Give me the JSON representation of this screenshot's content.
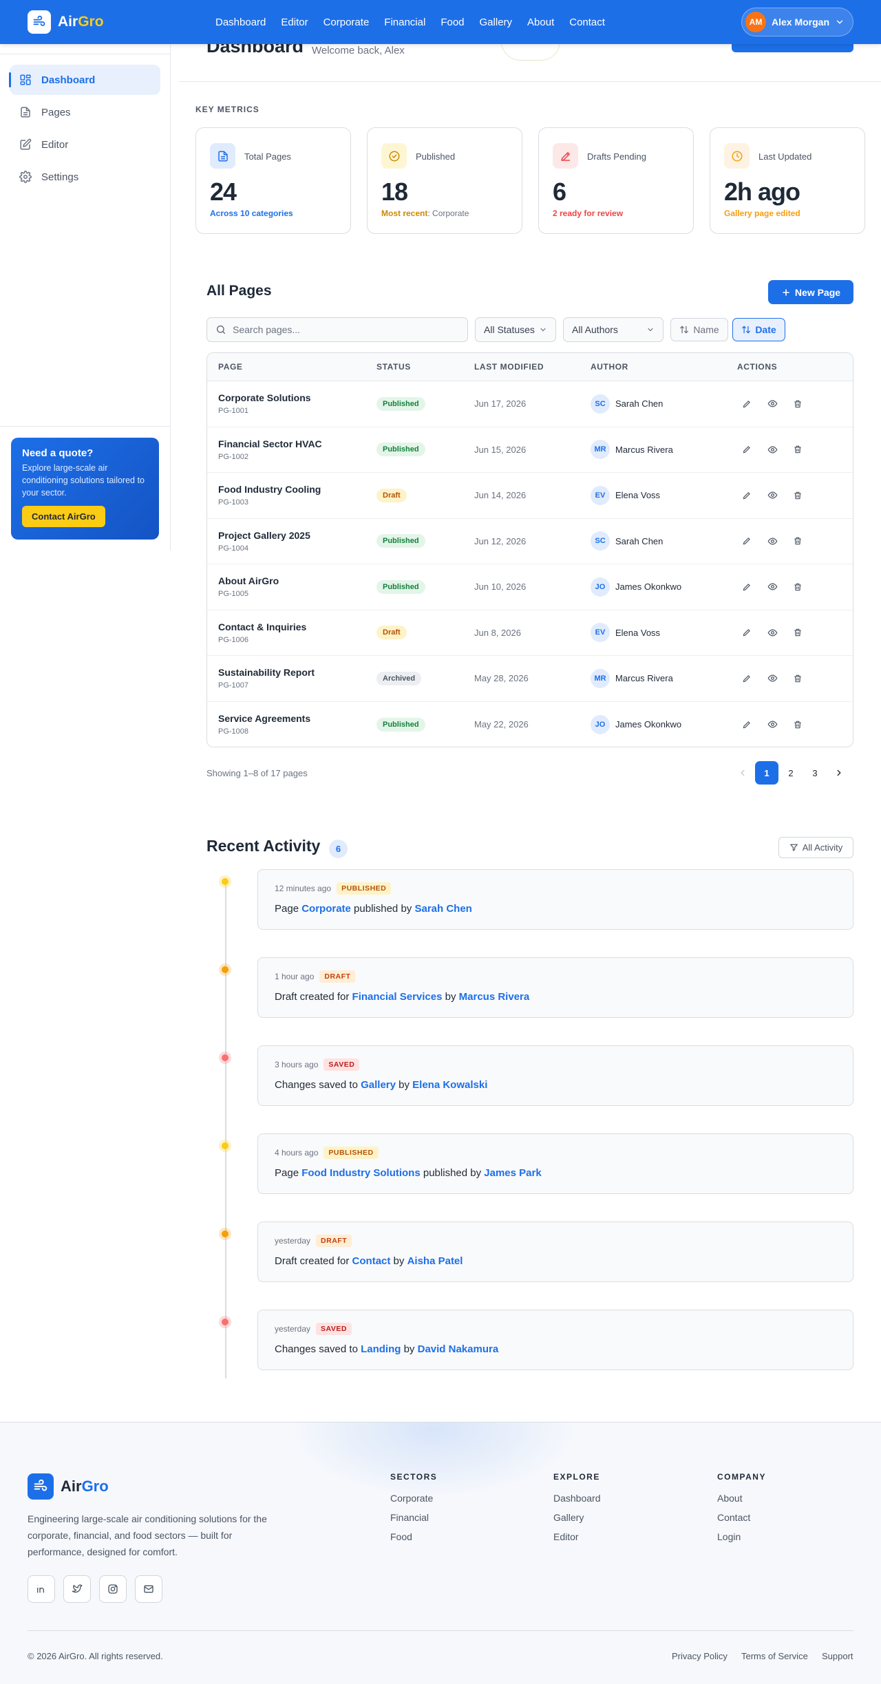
{
  "brand": {
    "name_part1": "Air",
    "name_part2": "Gro"
  },
  "nav": [
    "Dashboard",
    "Editor",
    "Corporate",
    "Financial",
    "Food",
    "Gallery",
    "About",
    "Contact"
  ],
  "user": {
    "initials": "AM",
    "name": "Alex Morgan"
  },
  "sidebar": {
    "items": [
      {
        "label": "Dashboard",
        "icon": "dashboard-icon",
        "active": true
      },
      {
        "label": "Pages",
        "icon": "pages-icon",
        "active": false
      },
      {
        "label": "Editor",
        "icon": "editor-icon",
        "active": false
      },
      {
        "label": "Settings",
        "icon": "gear-icon",
        "active": false
      }
    ],
    "quote": {
      "title": "Need a quote?",
      "text": "Explore large-scale air conditioning solutions tailored to your sector.",
      "button": "Contact AirGro"
    }
  },
  "header": {
    "title": "Dashboard",
    "subtitle": "Welcome back, Alex"
  },
  "metrics": {
    "label": "KEY METRICS",
    "cards": [
      {
        "label": "Total Pages",
        "value": "24",
        "note": "Across 10 categories",
        "note_extra": "",
        "accent": "#1d6fe8",
        "icon": "document-icon"
      },
      {
        "label": "Published",
        "value": "18",
        "note": "Most recent",
        "note_extra": ": Corporate",
        "accent": "#ca8a04",
        "icon": "check-circle-icon"
      },
      {
        "label": "Drafts Pending",
        "value": "6",
        "note": "2 ready for review",
        "note_extra": "",
        "accent": "#ef4444",
        "icon": "pencil-icon"
      },
      {
        "label": "Last Updated",
        "value": "2h ago",
        "note": "Gallery page edited",
        "note_extra": "",
        "accent": "#f59e0b",
        "icon": "clock-icon"
      }
    ]
  },
  "pages": {
    "title": "All Pages",
    "new_button": "New Page",
    "search_placeholder": "Search pages...",
    "status_filter": "All Statuses",
    "author_filter": "All Authors",
    "sort_name": "Name",
    "sort_date": "Date",
    "columns": [
      "PAGE",
      "STATUS",
      "LAST MODIFIED",
      "AUTHOR",
      "ACTIONS"
    ],
    "rows": [
      {
        "name": "Corporate Solutions",
        "id": "PG-1001",
        "status": "Published",
        "modified": "Jun 17, 2026",
        "initials": "SC",
        "author": "Sarah Chen"
      },
      {
        "name": "Financial Sector HVAC",
        "id": "PG-1002",
        "status": "Published",
        "modified": "Jun 15, 2026",
        "initials": "MR",
        "author": "Marcus Rivera"
      },
      {
        "name": "Food Industry Cooling",
        "id": "PG-1003",
        "status": "Draft",
        "modified": "Jun 14, 2026",
        "initials": "EV",
        "author": "Elena Voss"
      },
      {
        "name": "Project Gallery 2025",
        "id": "PG-1004",
        "status": "Published",
        "modified": "Jun 12, 2026",
        "initials": "SC",
        "author": "Sarah Chen"
      },
      {
        "name": "About AirGro",
        "id": "PG-1005",
        "status": "Published",
        "modified": "Jun 10, 2026",
        "initials": "JO",
        "author": "James Okonkwo"
      },
      {
        "name": "Contact & Inquiries",
        "id": "PG-1006",
        "status": "Draft",
        "modified": "Jun 8, 2026",
        "initials": "EV",
        "author": "Elena Voss"
      },
      {
        "name": "Sustainability Report",
        "id": "PG-1007",
        "status": "Archived",
        "modified": "May 28, 2026",
        "initials": "MR",
        "author": "Marcus Rivera"
      },
      {
        "name": "Service Agreements",
        "id": "PG-1008",
        "status": "Published",
        "modified": "May 22, 2026",
        "initials": "JO",
        "author": "James Okonkwo"
      }
    ],
    "showing": "Showing 1–8 of 17 pages",
    "pagination": [
      "1",
      "2",
      "3"
    ],
    "current_page": "1"
  },
  "activity": {
    "title": "Recent Activity",
    "count": "6",
    "filter_button": "All Activity",
    "items": [
      {
        "time": "12 minutes ago",
        "tag": "PUBLISHED",
        "kind": "pub",
        "pre": "Page ",
        "target": "Corporate",
        "mid": " published by ",
        "person": "Sarah Chen",
        "dot": "#facc15"
      },
      {
        "time": "1 hour ago",
        "tag": "DRAFT",
        "kind": "draft",
        "pre": "Draft created for ",
        "target": "Financial Services",
        "mid": " by ",
        "person": "Marcus Rivera",
        "dot": "#f59e0b"
      },
      {
        "time": "3 hours ago",
        "tag": "SAVED",
        "kind": "saved",
        "pre": "Changes saved to ",
        "target": "Gallery",
        "mid": " by ",
        "person": "Elena Kowalski",
        "dot": "#f87171"
      },
      {
        "time": "4 hours ago",
        "tag": "PUBLISHED",
        "kind": "pub",
        "pre": "Page ",
        "target": "Food Industry Solutions",
        "mid": " published by ",
        "person": "James Park",
        "dot": "#facc15"
      },
      {
        "time": "yesterday",
        "tag": "DRAFT",
        "kind": "draft",
        "pre": "Draft created for ",
        "target": "Contact",
        "mid": " by ",
        "person": "Aisha Patel",
        "dot": "#f59e0b"
      },
      {
        "time": "yesterday",
        "tag": "SAVED",
        "kind": "saved",
        "pre": "Changes saved to ",
        "target": "Landing",
        "mid": " by ",
        "person": "David Nakamura",
        "dot": "#f87171"
      }
    ]
  },
  "footer": {
    "description": "Engineering large-scale air conditioning solutions for the corporate, financial, and food sectors — built for performance, designed for comfort.",
    "socials": [
      "linkedin-icon",
      "twitter-icon",
      "instagram-icon",
      "mail-icon"
    ],
    "columns": [
      {
        "title": "SECTORS",
        "links": [
          "Corporate",
          "Financial",
          "Food"
        ]
      },
      {
        "title": "EXPLORE",
        "links": [
          "Dashboard",
          "Gallery",
          "Editor"
        ]
      },
      {
        "title": "COMPANY",
        "links": [
          "About",
          "Contact",
          "Login"
        ]
      }
    ],
    "copyright": "© 2026 AirGro. All rights reserved.",
    "legal": [
      "Privacy Policy",
      "Terms of Service",
      "Support"
    ]
  }
}
